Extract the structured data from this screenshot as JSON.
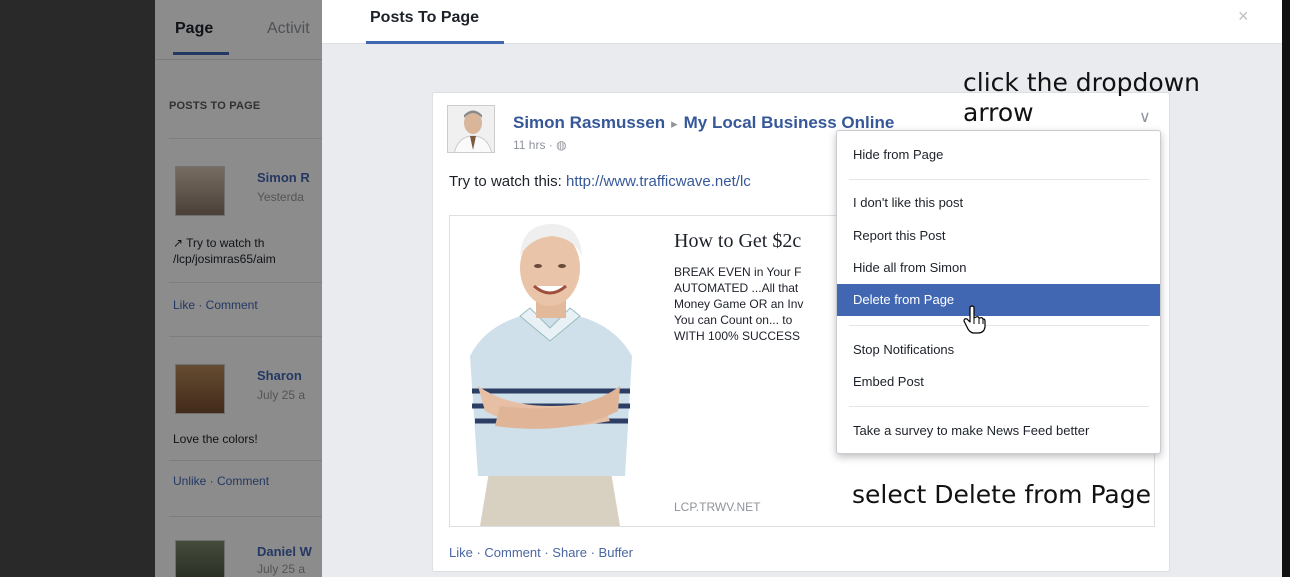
{
  "background": {
    "tabs": [
      "Page",
      "Activit"
    ],
    "heading": "POSTS TO PAGE",
    "posts": [
      {
        "name": "Simon R",
        "time": "Yesterda",
        "text_lines": [
          "↗ Try to watch th",
          "/lcp/josimras65/aim"
        ],
        "actions": "Like · Comment"
      },
      {
        "name": "Sharon",
        "time": "July 25 a",
        "text_lines": [
          "Love the colors!"
        ],
        "actions": "Unlike · Comment"
      },
      {
        "name": "Daniel W",
        "time": "July 25 a"
      }
    ]
  },
  "modal": {
    "title": "Posts To Page",
    "close_icon": "×"
  },
  "post": {
    "author": "Simon Rasmussen",
    "arrow": "▸",
    "target": "My Local Business Online",
    "time": "11 hrs · ◍",
    "text_prefix": "Try to watch this: ",
    "link": "http://www.trafficwave.net/lc",
    "chevron_icon": "∨",
    "attachment": {
      "title": "How to Get $2c",
      "description": "BREAK EVEN in Your F\nAUTOMATED ...All that\nMoney Game OR an Inv\nYou can Count on... to\nWITH 100% SUCCESS",
      "domain": "LCP.TRWV.NET"
    },
    "actions": "Like · Comment · Share · Buffer"
  },
  "menu": {
    "items": [
      {
        "label": "Hide from Page"
      },
      {
        "label": "I don't like this post"
      },
      {
        "label": "Report this Post"
      },
      {
        "label": "Hide all from Simon"
      },
      {
        "label": "Delete from Page",
        "active": true
      },
      {
        "label": "Stop Notifications"
      },
      {
        "label": "Embed Post"
      },
      {
        "label": "Take a survey to make News Feed better"
      }
    ]
  },
  "annotations": {
    "step1_line1": "click the dropdown",
    "step1_line2": "arrow",
    "step2": "select Delete from Page"
  },
  "colors": {
    "facebook_blue": "#4267b2",
    "link_blue": "#365899",
    "overlay": "#4b4b4b"
  }
}
